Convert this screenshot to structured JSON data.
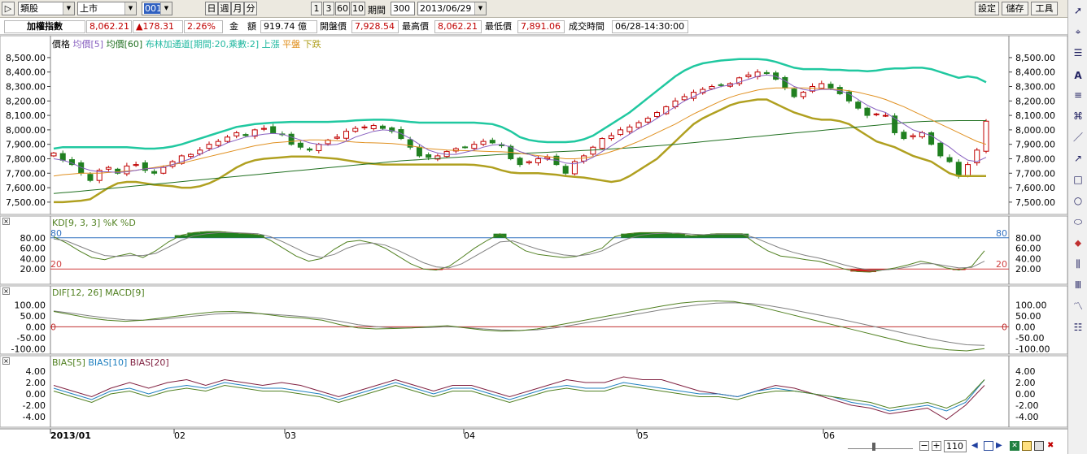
{
  "toolbar": {
    "category": "類股",
    "market": "上市",
    "code": "001",
    "period_buttons": [
      "日",
      "週",
      "月",
      "分"
    ],
    "range_buttons": [
      "1",
      "3",
      "60",
      "10"
    ],
    "period_label": "期間",
    "period_value": "300",
    "date_value": "2013/06/29",
    "right_buttons": [
      "設定",
      "儲存",
      "工具"
    ]
  },
  "quote": {
    "name": "加權指數",
    "price": "8,062.21",
    "change": "▲178.31",
    "change_pct": "2.26%",
    "amount_label": "金　額",
    "amount_value": "919.74 億",
    "open_label": "開盤價",
    "open_value": "7,928.54",
    "high_label": "最高價",
    "high_value": "8,062.21",
    "low_label": "最低價",
    "low_value": "7,891.06",
    "time_label": "成交時間",
    "time_value": "06/28-14:30:00"
  },
  "main_chart": {
    "legend": [
      {
        "text": "價格",
        "color": "#000000"
      },
      {
        "text": "均價[5]",
        "color": "#8860c0"
      },
      {
        "text": "均價[60]",
        "color": "#207020"
      },
      {
        "text": "布林加通道[期間:20,乘數:2] 上漲",
        "color": "#20b8a0"
      },
      {
        "text": "平盤",
        "color": "#e09020"
      },
      {
        "text": "下跌",
        "color": "#b0a020"
      }
    ],
    "y_ticks": [
      "8,500.00",
      "8,400.00",
      "8,300.00",
      "8,200.00",
      "8,100.00",
      "8,000.00",
      "7,900.00",
      "7,800.00",
      "7,700.00",
      "7,600.00",
      "7,500.00"
    ],
    "ylim": [
      7460,
      8550
    ]
  },
  "kd_chart": {
    "title": "KD[9, 3, 3]  %K  %D",
    "y_ticks": [
      "80.00",
      "60.00",
      "40.00",
      "20.00"
    ],
    "line_high": "80",
    "line_low": "20"
  },
  "macd_chart": {
    "title": "DIF[12, 26]  MACD[9]",
    "y_ticks": [
      "100.00",
      "50.00",
      "0.00",
      "-50.00",
      "-100.00"
    ],
    "zero_label": "0"
  },
  "bias_chart": {
    "title_parts": [
      {
        "text": "BIAS[5]",
        "color": "#508020"
      },
      {
        "text": "BIAS[10]",
        "color": "#2080c0"
      },
      {
        "text": "BIAS[20]",
        "color": "#802040"
      }
    ],
    "y_ticks": [
      "4.00",
      "2.00",
      "0.00",
      "-2.00",
      "-4.00"
    ]
  },
  "x_axis": {
    "labels": [
      "2013/01",
      "02",
      "03",
      "04",
      "05",
      "06"
    ]
  },
  "bottom": {
    "zoom_value": "110"
  },
  "colors": {
    "up_candle": "#c00000",
    "down_candle": "#208020",
    "ma5": "#8860c0",
    "ma20": "#e09020",
    "ma60": "#207020",
    "boll_upper": "#20c8a0",
    "boll_lower": "#b0a020"
  },
  "chart_data": {
    "type": "candlestick",
    "title": "加權指數",
    "categories_note": "",
    "close": [
      7840,
      7790,
      7760,
      7700,
      7650,
      7720,
      7740,
      7700,
      7750,
      7760,
      7720,
      7700,
      7740,
      7780,
      7820,
      7830,
      7860,
      7900,
      7920,
      7950,
      7980,
      7960,
      8000,
      8010,
      7980,
      7970,
      7900,
      7880,
      7860,
      7900,
      7930,
      7950,
      7990,
      8010,
      8020,
      8030,
      8010,
      7990,
      7940,
      7880,
      7820,
      7810,
      7820,
      7850,
      7870,
      7880,
      7900,
      7920,
      7910,
      7890,
      7800,
      7760,
      7780,
      7800,
      7810,
      7760,
      7700,
      7780,
      7820,
      7880,
      7940,
      7960,
      8000,
      8020,
      8050,
      8080,
      8120,
      8160,
      8200,
      8230,
      8260,
      8280,
      8300,
      8310,
      8320,
      8360,
      8380,
      8400,
      8390,
      8350,
      8290,
      8230,
      8260,
      8300,
      8320,
      8290,
      8250,
      8200,
      8150,
      8100,
      8110,
      8100,
      7980,
      7940,
      7960,
      7980,
      7900,
      7820,
      7780,
      7680,
      7760,
      7860,
      8060
    ],
    "ma5": [
      7800,
      7790,
      7770,
      7740,
      7720,
      7710,
      7710,
      7705,
      7710,
      7720,
      7730,
      7735,
      7740,
      7760,
      7780,
      7800,
      7830,
      7860,
      7880,
      7910,
      7930,
      7950,
      7960,
      7970,
      7975,
      7970,
      7950,
      7930,
      7910,
      7900,
      7895,
      7900,
      7920,
      7950,
      7970,
      7990,
      8000,
      7995,
      7975,
      7940,
      7900,
      7860,
      7840,
      7830,
      7830,
      7845,
      7860,
      7880,
      7895,
      7900,
      7880,
      7850,
      7830,
      7810,
      7795,
      7790,
      7770,
      7765,
      7780,
      7810,
      7850,
      7890,
      7930,
      7970,
      8010,
      8040,
      8080,
      8120,
      8160,
      8200,
      8230,
      8260,
      8280,
      8300,
      8310,
      8330,
      8350,
      8370,
      8380,
      8370,
      8340,
      8300,
      8280,
      8270,
      8280,
      8280,
      8270,
      8250,
      8210,
      8170,
      8140,
      8120,
      8080,
      8040,
      8000,
      7980,
      7960,
      7920,
      7880,
      7830,
      7790,
      7780,
      7810
    ],
    "ma20": [
      7680,
      7690,
      7695,
      7700,
      7700,
      7700,
      7705,
      7710,
      7715,
      7720,
      7730,
      7740,
      7750,
      7760,
      7770,
      7785,
      7800,
      7815,
      7830,
      7845,
      7860,
      7875,
      7890,
      7900,
      7910,
      7915,
      7920,
      7925,
      7930,
      7930,
      7928,
      7925,
      7920,
      7915,
      7912,
      7910,
      7908,
      7905,
      7900,
      7890,
      7880,
      7870,
      7865,
      7860,
      7858,
      7856,
      7855,
      7852,
      7850,
      7848,
      7845,
      7838,
      7830,
      7822,
      7815,
      7808,
      7800,
      7800,
      7805,
      7815,
      7830,
      7850,
      7870,
      7895,
      7920,
      7950,
      7980,
      8010,
      8040,
      8075,
      8110,
      8140,
      8170,
      8200,
      8225,
      8245,
      8260,
      8275,
      8285,
      8290,
      8290,
      8290,
      8290,
      8288,
      8285,
      8282,
      8278,
      8270,
      8260,
      8245,
      8230,
      8210,
      8185,
      8160,
      8130,
      8100,
      8070,
      8040,
      8010,
      7980,
      7950,
      7920,
      7900
    ],
    "ma60": [
      7560,
      7565,
      7570,
      7576,
      7582,
      7588,
      7594,
      7600,
      7606,
      7612,
      7618,
      7624,
      7630,
      7636,
      7642,
      7648,
      7654,
      7660,
      7666,
      7672,
      7678,
      7684,
      7690,
      7696,
      7702,
      7708,
      7714,
      7720,
      7726,
      7732,
      7738,
      7744,
      7750,
      7756,
      7762,
      7768,
      7774,
      7780,
      7786,
      7790,
      7794,
      7798,
      7802,
      7806,
      7810,
      7814,
      7818,
      7822,
      7826,
      7830,
      7833,
      7836,
      7839,
      7842,
      7845,
      7848,
      7851,
      7854,
      7857,
      7860,
      7864,
      7868,
      7872,
      7876,
      7880,
      7885,
      7890,
      7895,
      7900,
      7906,
      7912,
      7918,
      7924,
      7930,
      7936,
      7942,
      7948,
      7954,
      7960,
      7966,
      7972,
      7978,
      7984,
      7990,
      7996,
      8002,
      8008,
      8014,
      8020,
      8026,
      8032,
      8038,
      8044,
      8050,
      8054,
      8058,
      8060,
      8062,
      8063,
      8064,
      8064,
      8064,
      8064
    ],
    "boll_upper": [
      7870,
      7880,
      7880,
      7880,
      7880,
      7880,
      7880,
      7880,
      7880,
      7875,
      7870,
      7870,
      7875,
      7885,
      7900,
      7920,
      7940,
      7960,
      7980,
      8000,
      8020,
      8030,
      8040,
      8045,
      8050,
      8052,
      8055,
      8055,
      8055,
      8055,
      8055,
      8058,
      8060,
      8065,
      8068,
      8070,
      8070,
      8068,
      8062,
      8055,
      8050,
      8050,
      8050,
      8050,
      8050,
      8050,
      8050,
      8045,
      8040,
      8020,
      7990,
      7950,
      7930,
      7920,
      7915,
      7915,
      7915,
      7920,
      7935,
      7960,
      8000,
      8040,
      8080,
      8120,
      8170,
      8220,
      8270,
      8320,
      8370,
      8410,
      8440,
      8460,
      8470,
      8480,
      8485,
      8490,
      8490,
      8490,
      8485,
      8470,
      8450,
      8430,
      8420,
      8420,
      8420,
      8415,
      8415,
      8410,
      8410,
      8405,
      8410,
      8420,
      8425,
      8425,
      8430,
      8430,
      8420,
      8400,
      8380,
      8360,
      8370,
      8360,
      8330
    ],
    "boll_lower": [
      7500,
      7500,
      7505,
      7510,
      7520,
      7560,
      7600,
      7630,
      7640,
      7640,
      7630,
      7620,
      7615,
      7610,
      7600,
      7600,
      7610,
      7630,
      7660,
      7700,
      7740,
      7770,
      7790,
      7800,
      7805,
      7810,
      7815,
      7815,
      7815,
      7810,
      7805,
      7800,
      7790,
      7780,
      7770,
      7765,
      7760,
      7760,
      7760,
      7760,
      7760,
      7760,
      7760,
      7760,
      7760,
      7760,
      7758,
      7750,
      7740,
      7720,
      7705,
      7700,
      7700,
      7700,
      7695,
      7690,
      7680,
      7675,
      7670,
      7660,
      7650,
      7640,
      7650,
      7680,
      7720,
      7760,
      7800,
      7860,
      7920,
      7980,
      8040,
      8080,
      8110,
      8140,
      8170,
      8190,
      8200,
      8210,
      8210,
      8180,
      8150,
      8120,
      8100,
      8080,
      8070,
      8070,
      8060,
      8040,
      8000,
      7960,
      7920,
      7900,
      7880,
      7850,
      7820,
      7800,
      7780,
      7740,
      7700,
      7680,
      7680,
      7680,
      7680
    ],
    "kd_k": [
      82,
      70,
      55,
      42,
      38,
      45,
      50,
      42,
      55,
      72,
      85,
      90,
      92,
      92,
      90,
      88,
      86,
      75,
      60,
      45,
      35,
      40,
      58,
      72,
      75,
      70,
      60,
      45,
      30,
      20,
      18,
      25,
      42,
      60,
      75,
      88,
      70,
      55,
      48,
      45,
      42,
      44,
      52,
      60,
      82,
      88,
      90,
      90,
      90,
      88,
      84,
      86,
      88,
      88,
      88,
      70,
      55,
      45,
      42,
      38,
      35,
      28,
      20,
      15,
      14,
      18,
      22,
      28,
      35,
      30,
      22,
      18,
      25,
      55
    ],
    "kd_d": [
      78,
      74,
      64,
      54,
      46,
      44,
      46,
      46,
      50,
      62,
      75,
      84,
      88,
      90,
      90,
      89,
      88,
      82,
      72,
      60,
      48,
      42,
      48,
      60,
      68,
      70,
      66,
      56,
      44,
      32,
      24,
      22,
      30,
      44,
      58,
      72,
      74,
      66,
      58,
      52,
      47,
      45,
      48,
      55,
      68,
      78,
      85,
      88,
      89,
      89,
      87,
      86,
      87,
      87,
      87,
      80,
      70,
      60,
      52,
      46,
      41,
      35,
      28,
      22,
      18,
      18,
      20,
      24,
      30,
      30,
      26,
      22,
      23,
      35
    ],
    "macd_dif": [
      70,
      55,
      40,
      30,
      25,
      30,
      40,
      50,
      60,
      68,
      70,
      65,
      55,
      45,
      40,
      30,
      10,
      -5,
      -10,
      -8,
      -5,
      0,
      5,
      -5,
      -15,
      -20,
      -18,
      -10,
      5,
      20,
      35,
      50,
      65,
      80,
      95,
      108,
      115,
      118,
      115,
      100,
      80,
      60,
      40,
      20,
      0,
      -20,
      -40,
      -60,
      -80,
      -95,
      -105,
      -110,
      -100
    ],
    "macd_signal": [
      72,
      62,
      50,
      40,
      32,
      30,
      34,
      42,
      50,
      58,
      62,
      62,
      58,
      52,
      46,
      38,
      25,
      10,
      0,
      -5,
      -5,
      -3,
      0,
      -3,
      -10,
      -15,
      -17,
      -14,
      -5,
      8,
      22,
      36,
      50,
      64,
      78,
      90,
      100,
      108,
      110,
      106,
      96,
      82,
      66,
      50,
      34,
      16,
      -2,
      -20,
      -38,
      -55,
      -70,
      -82,
      -85
    ],
    "bias5": [
      0.5,
      -0.5,
      -1.5,
      0,
      0.5,
      -0.5,
      0.5,
      1.0,
      0.5,
      1.5,
      1.0,
      0.5,
      0.5,
      0,
      -0.5,
      -1.5,
      -0.5,
      0.5,
      1.5,
      0.5,
      -0.5,
      0.5,
      0.5,
      -0.5,
      -1.5,
      -0.5,
      0.5,
      1.0,
      0.5,
      0.5,
      1.5,
      1.0,
      0.5,
      0,
      -0.5,
      -0.5,
      -1.0,
      0,
      0.5,
      0.5,
      0,
      -0.5,
      -1.0,
      -1.5,
      -2.5,
      -2.0,
      -1.5,
      -2.5,
      -1.0,
      2.5
    ],
    "bias10": [
      1.0,
      0,
      -1.0,
      0.5,
      1.0,
      0,
      1.0,
      1.5,
      1.0,
      2.0,
      1.5,
      1.0,
      1.0,
      0.5,
      0,
      -1.0,
      0,
      1.0,
      2.0,
      1.0,
      0,
      1.0,
      1.0,
      0,
      -1.0,
      0,
      1.0,
      1.5,
      1.0,
      1.0,
      2.0,
      1.5,
      1.0,
      0.5,
      0,
      0,
      -0.5,
      0.5,
      1.0,
      0.5,
      0,
      -0.5,
      -1.5,
      -2.0,
      -3.0,
      -2.5,
      -2.0,
      -3.0,
      -1.5,
      2.5
    ],
    "bias20": [
      1.5,
      0.5,
      -0.5,
      1.0,
      2.0,
      1.0,
      2.0,
      2.5,
      1.5,
      2.5,
      2.0,
      1.5,
      2.0,
      1.5,
      0.5,
      -0.5,
      0.5,
      1.5,
      2.5,
      1.5,
      0.5,
      1.5,
      1.5,
      0.5,
      -0.5,
      0.5,
      1.5,
      2.5,
      2.0,
      2.0,
      3.0,
      2.5,
      2.5,
      1.5,
      0.5,
      0,
      -0.5,
      0.5,
      1.5,
      1.0,
      0,
      -1.0,
      -2.0,
      -2.5,
      -3.5,
      -3.0,
      -2.5,
      -4.5,
      -2.0,
      1.5
    ]
  }
}
